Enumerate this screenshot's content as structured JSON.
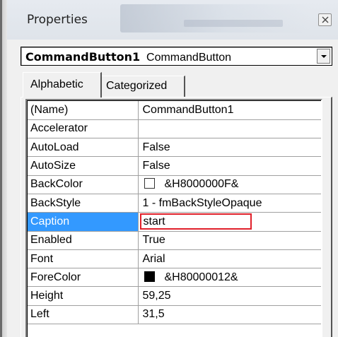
{
  "window": {
    "title": "Properties",
    "close_icon": "close-icon"
  },
  "object_selector": {
    "object_name": "CommandButton1",
    "object_type": "CommandButton"
  },
  "tabs": [
    {
      "label": "Alphabetic",
      "active": true
    },
    {
      "label": "Categorized",
      "active": false
    }
  ],
  "properties": [
    {
      "name": "(Name)",
      "value": "CommandButton1"
    },
    {
      "name": "Accelerator",
      "value": ""
    },
    {
      "name": "AutoLoad",
      "value": "False"
    },
    {
      "name": "AutoSize",
      "value": "False"
    },
    {
      "name": "BackColor",
      "value": "&H8000000F&",
      "swatch": "#ffffff"
    },
    {
      "name": "BackStyle",
      "value": "1 - fmBackStyleOpaque"
    },
    {
      "name": "Caption",
      "value": "start",
      "selected": true,
      "highlight_color": "#e0202a"
    },
    {
      "name": "Enabled",
      "value": "True"
    },
    {
      "name": "Font",
      "value": "Arial"
    },
    {
      "name": "ForeColor",
      "value": "&H80000012&",
      "swatch": "#000000"
    },
    {
      "name": "Height",
      "value": "59,25"
    },
    {
      "name": "Left",
      "value": "31,5"
    }
  ],
  "colors": {
    "selection": "#3399ff",
    "highlight_box": "#e0202a"
  }
}
